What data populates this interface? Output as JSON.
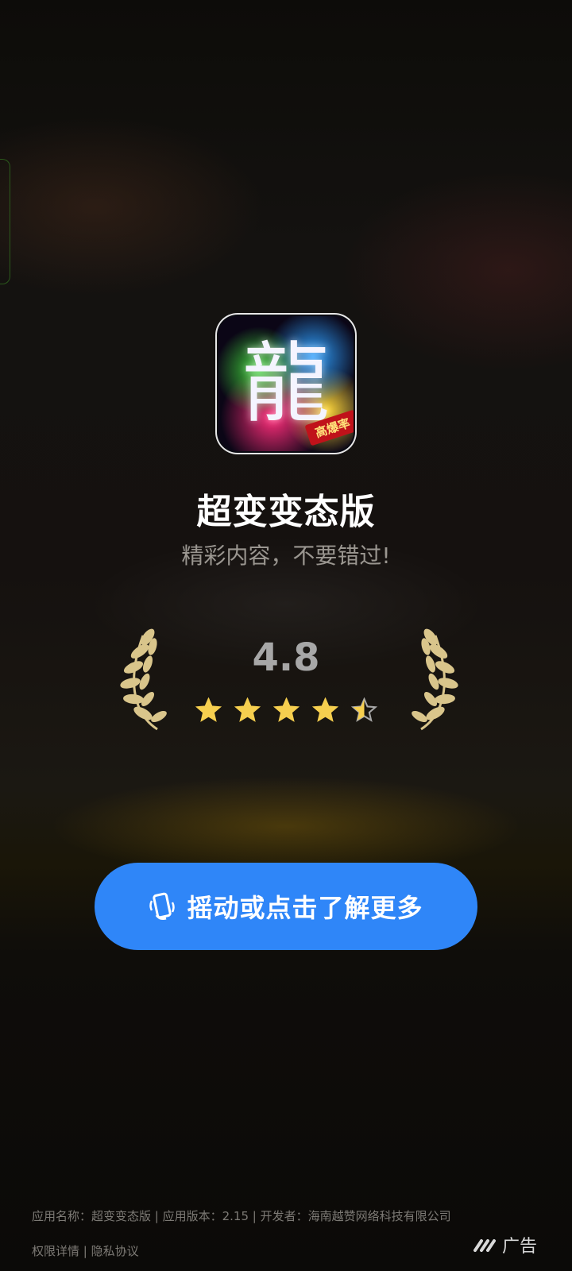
{
  "app": {
    "name": "超变变态版",
    "tagline": "精彩内容，不要错过!",
    "icon_glyph": "龍",
    "icon_badge": "高爆率"
  },
  "rating": {
    "value": "4.8",
    "stars_total": 5,
    "stars_filled": 4.5
  },
  "cta": {
    "label": "摇动或点击了解更多",
    "icon": "shake-phone-icon"
  },
  "footer": {
    "info": "应用名称：超变变态版 | 应用版本：2.15 | 开发者：海南越赞网络科技有限公司",
    "permissions": "权限详情",
    "separator": " | ",
    "privacy": "隐私协议"
  },
  "ad": {
    "label": "广告",
    "logo_icon": "ad-network-logo-icon"
  },
  "colors": {
    "accent": "#2f86f8",
    "star": "#f6cf4f",
    "laurel": "#d9c58b"
  }
}
